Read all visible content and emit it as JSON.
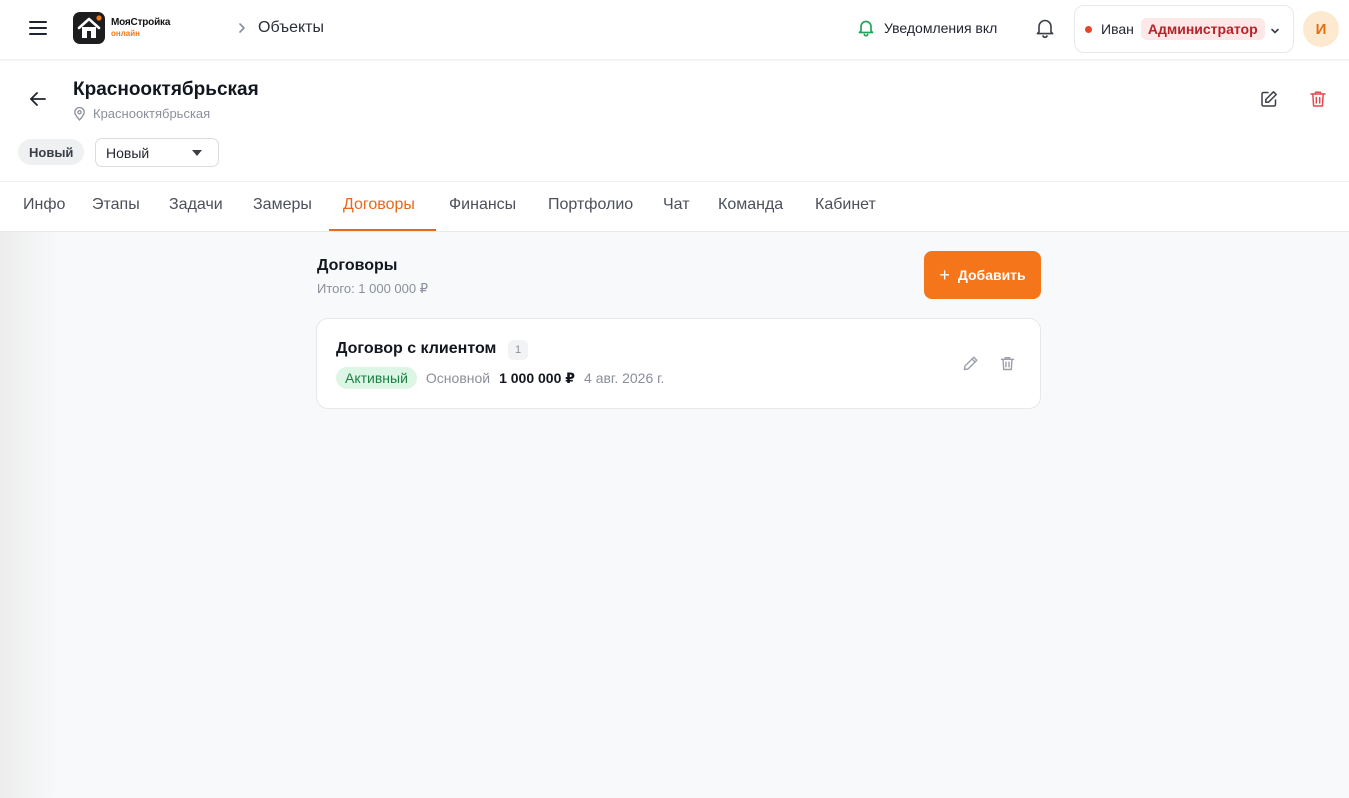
{
  "app": {
    "logo_name": "МояСтройка",
    "logo_sub": "онлайн"
  },
  "topbar": {
    "breadcrumb": "Объекты",
    "notifications_label": "Уведомления вкл",
    "user_name": "Иван",
    "user_role": "Администратор",
    "avatar_initial": "И"
  },
  "object": {
    "title": "Краснооктябрьская",
    "address": "Краснооктябрьская",
    "status_chip": "Новый",
    "status_select_value": "Новый"
  },
  "tabs": [
    {
      "label": "Инфо"
    },
    {
      "label": "Этапы"
    },
    {
      "label": "Задачи"
    },
    {
      "label": "Замеры"
    },
    {
      "label": "Договоры",
      "active": true
    },
    {
      "label": "Финансы"
    },
    {
      "label": "Портфолио"
    },
    {
      "label": "Чат"
    },
    {
      "label": "Команда"
    },
    {
      "label": "Кабинет"
    }
  ],
  "contracts": {
    "title": "Договоры",
    "total": "Итого: 1 000 000 ₽",
    "add_label": "Добавить",
    "items": [
      {
        "title": "Договор с клиентом",
        "count": "1",
        "status": "Активный",
        "type": "Основной",
        "amount": "1 000 000 ₽",
        "date": "4 авг. 2026 г."
      }
    ]
  },
  "colors": {
    "accent": "#f5761a",
    "role_badge_text": "#b4232a",
    "active_badge_bg": "#dcf5e4",
    "notification_green": "#22a55a",
    "delete_red": "#e5484d"
  }
}
